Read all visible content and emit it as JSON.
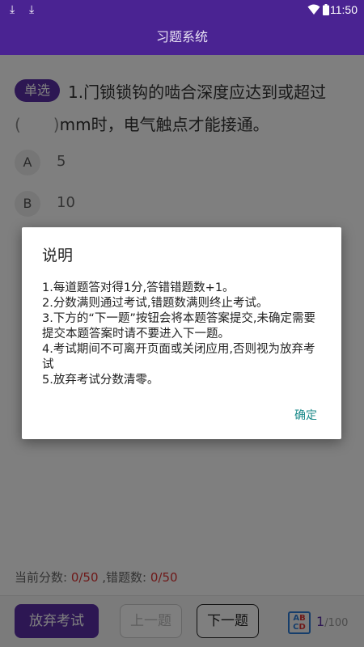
{
  "status": {
    "time": "11:50",
    "icons": [
      "download-icon",
      "download-icon",
      "wifi-icon",
      "battery-icon"
    ]
  },
  "app": {
    "title": "习题系统"
  },
  "question": {
    "type_tag": "单选",
    "text_part1": "1.门锁锁钩的啮合深度应达到或超过",
    "paren": "(　　)",
    "text_part2": "mm时，电气触点才能接通。",
    "options": [
      {
        "letter": "A",
        "text": "5"
      },
      {
        "letter": "B",
        "text": "10"
      }
    ]
  },
  "score": {
    "label_score": "当前分数: ",
    "score": "0/50",
    "label_errors": " ,错题数: ",
    "errors": "0/50"
  },
  "toolbar": {
    "quit": "放弃考试",
    "prev": "上一题",
    "next": "下一题",
    "current": "1",
    "total": "/100",
    "abcd": [
      "A",
      "B",
      "C",
      "D"
    ]
  },
  "dialog": {
    "title": "说明",
    "lines": [
      "1.每道题答对得1分,答错错题数+1。",
      "2.分数满则通过考试,错题数满则终止考试。",
      "3.下方的“下一题”按钮会将本题答案提交,未确定需要提交本题答案时请不要进入下一题。",
      "4.考试期间不可离开页面或关闭应用,否则视为放弃考试",
      "5.放弃考试分数清零。"
    ],
    "ok": "确定"
  },
  "colors": {
    "primary": "#4a2392",
    "accent": "#5a2ea6",
    "error_red": "#d33333",
    "ok_teal": "#1c8a8a"
  }
}
